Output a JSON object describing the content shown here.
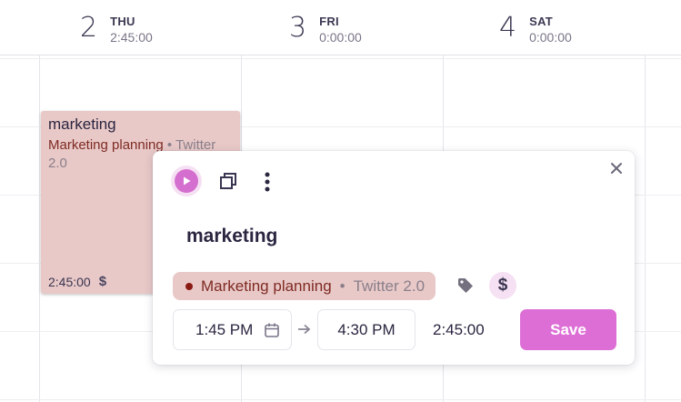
{
  "days": [
    {
      "number": "2",
      "name": "THU",
      "total": "2:45:00"
    },
    {
      "number": "3",
      "name": "FRI",
      "total": "0:00:00"
    },
    {
      "number": "4",
      "name": "SAT",
      "total": "0:00:00"
    }
  ],
  "entry": {
    "description": "marketing",
    "project": "Marketing planning",
    "separator": "•",
    "client": "Twitter 2.0",
    "duration": "2:45:00",
    "billable_symbol": "$",
    "color": "#e8c9c8"
  },
  "popover": {
    "description": "marketing",
    "project": "Marketing planning",
    "separator": "•",
    "client": "Twitter 2.0",
    "project_color": "#8b1a12",
    "billable_symbol": "$",
    "start_time": "1:45 PM",
    "end_time": "4:30 PM",
    "duration": "2:45:00",
    "save_label": "Save",
    "accent": "#dd6ed6",
    "icons": [
      "play-icon",
      "duplicate-icon",
      "more-vertical-icon",
      "close-icon",
      "tag-icon",
      "dollar-icon",
      "calendar-icon",
      "arrow-right-icon"
    ]
  }
}
